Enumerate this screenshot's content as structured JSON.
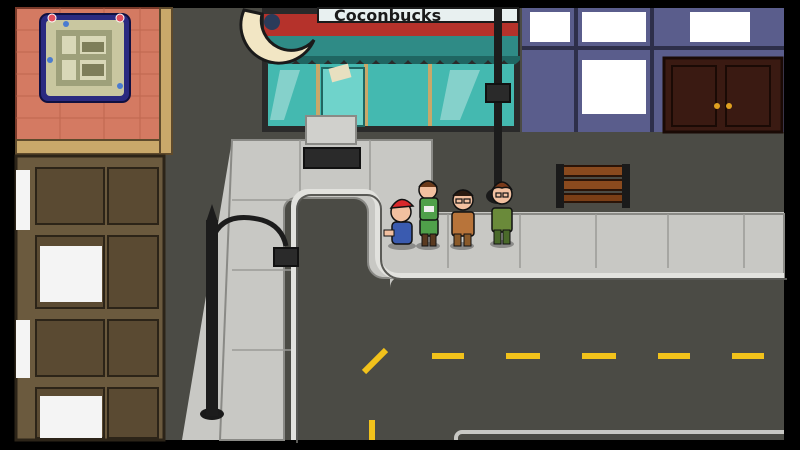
{
  "scene": {
    "shop_sign_text": "Coconbucks"
  },
  "minimap": {
    "markers": [
      {
        "icon": "player-marker-icon",
        "color": "#e04f5f"
      },
      {
        "icon": "player-marker-icon",
        "color": "#e04f5f"
      },
      {
        "icon": "npc-marker-icon",
        "color": "#4a7bd0"
      },
      {
        "icon": "npc-marker-icon",
        "color": "#4a7bd0"
      },
      {
        "icon": "npc-marker-icon",
        "color": "#4a7bd0"
      }
    ]
  },
  "party": {
    "members": [
      {
        "icon": "character-red-cap-icon"
      },
      {
        "icon": "character-green-shirt-icon"
      },
      {
        "icon": "character-glasses-brown-suit-icon"
      },
      {
        "icon": "character-brown-hair-green-vest-icon"
      }
    ]
  },
  "colors": {
    "road": "#4b4b45",
    "sidewalk": "#c8c8c4",
    "lane_marking": "#f2c21b",
    "brick": "#d47a62",
    "shop_trim": "#b5322b",
    "shop_glass": "#44b9b0"
  }
}
